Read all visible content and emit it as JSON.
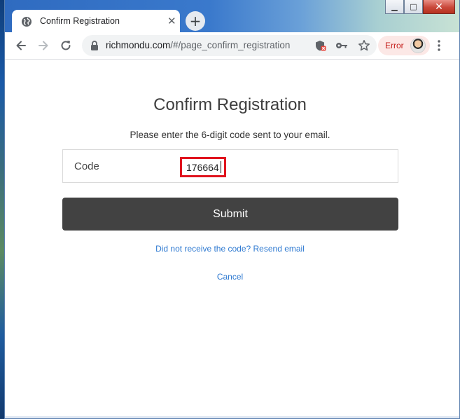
{
  "browser": {
    "tab_title": "Confirm Registration",
    "tab_close_glyph": "✕",
    "new_tab_glyph": "+",
    "url_host": "richmondu.com",
    "url_path": "/#/page_confirm_registration",
    "profile_status": "Error",
    "window_controls": {
      "minimize": "▁",
      "maximize": "□",
      "close": "✕"
    },
    "icons": [
      "back-arrow-icon",
      "forward-arrow-icon",
      "reload-icon",
      "lock-icon",
      "shield-blocked-icon",
      "key-icon",
      "star-icon",
      "avatar",
      "more-menu-icon"
    ]
  },
  "page": {
    "title": "Confirm Registration",
    "instructions": "Please enter the 6-digit code sent to your email.",
    "code_label": "Code",
    "code_value": "176664",
    "submit_label": "Submit",
    "resend_link": "Did not receive the code? Resend email",
    "cancel_link": "Cancel"
  },
  "colors": {
    "submit_bg": "#424242",
    "link": "#2f7ad1",
    "highlight_border": "#e0141e",
    "error_chip_bg": "#fce8e6",
    "error_text": "#c5221f"
  }
}
